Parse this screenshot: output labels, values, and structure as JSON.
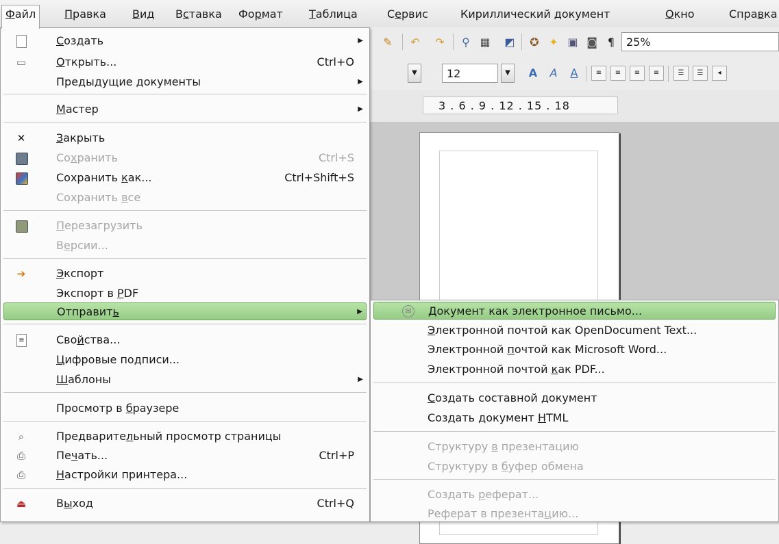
{
  "menubar": {
    "items": [
      {
        "pre": "",
        "acc": "Ф",
        "post": "айл"
      },
      {
        "pre": "",
        "acc": "П",
        "post": "равка"
      },
      {
        "pre": "",
        "acc": "В",
        "post": "ид"
      },
      {
        "pre": "В",
        "acc": "с",
        "post": "тавка"
      },
      {
        "pre": "Фо",
        "acc": "р",
        "post": "мат"
      },
      {
        "pre": "",
        "acc": "Т",
        "post": "аблица"
      },
      {
        "pre": "С",
        "acc": "е",
        "post": "рвис"
      },
      {
        "pre": "Кириллический документ",
        "acc": "",
        "post": ""
      },
      {
        "pre": "",
        "acc": "О",
        "post": "кно"
      },
      {
        "pre": "Спра",
        "acc": "в",
        "post": "ка"
      }
    ]
  },
  "toolbar": {
    "zoom_value": "25%",
    "font_size_value": "12"
  },
  "ruler": {
    "text": "3 . 6 . 9 . 12 . 15 . 18"
  },
  "file_menu": {
    "items": [
      {
        "pre": "",
        "acc": "С",
        "post": "оздать",
        "shortcut": "",
        "submenu": true,
        "icon": "new-document-icon",
        "glyph": ""
      },
      {
        "pre": "",
        "acc": "О",
        "post": "ткрыть...",
        "shortcut": "Ctrl+O",
        "icon": "open-folder-icon",
        "glyph": "▭"
      },
      {
        "pre": "Предыдущие ",
        "acc": "д",
        "post": "окументы",
        "shortcut": "",
        "submenu": true
      },
      {
        "pre": "",
        "acc": "М",
        "post": "астер",
        "shortcut": "",
        "submenu": true
      },
      {
        "pre": "",
        "acc": "З",
        "post": "акрыть",
        "shortcut": "",
        "icon": "close-icon",
        "glyph": "✕"
      },
      {
        "pre": "Со",
        "acc": "х",
        "post": "ранить",
        "shortcut": "Ctrl+S",
        "disabled": true,
        "icon": "save-icon"
      },
      {
        "pre": "Сохранить ",
        "acc": "к",
        "post": "ак...",
        "shortcut": "Ctrl+Shift+S",
        "icon": "save-as-icon"
      },
      {
        "pre": "Сохранить ",
        "acc": "в",
        "post": "се",
        "shortcut": "",
        "disabled": true
      },
      {
        "pre": "",
        "acc": "П",
        "post": "ерезагрузить",
        "shortcut": "",
        "disabled": true,
        "icon": "reload-icon"
      },
      {
        "pre": "В",
        "acc": "е",
        "post": "рсии...",
        "shortcut": "",
        "disabled": true
      },
      {
        "pre": "",
        "acc": "Э",
        "post": "кспорт",
        "shortcut": "",
        "icon": "export-icon",
        "glyph": "➔"
      },
      {
        "pre": "Экспорт в ",
        "acc": "P",
        "post": "DF",
        "shortcut": ""
      },
      {
        "pre": "Отправит",
        "acc": "ь",
        "post": "",
        "shortcut": "",
        "submenu": true,
        "highlighted": true
      },
      {
        "pre": "Сво",
        "acc": "й",
        "post": "ства...",
        "shortcut": "",
        "icon": "properties-icon",
        "glyph": "≡"
      },
      {
        "pre": "",
        "acc": "Ц",
        "post": "ифровые подписи...",
        "shortcut": ""
      },
      {
        "pre": "",
        "acc": "Ш",
        "post": "аблоны",
        "shortcut": "",
        "submenu": true
      },
      {
        "pre": "Просмотр в ",
        "acc": "б",
        "post": "раузере",
        "shortcut": ""
      },
      {
        "pre": "Предварите",
        "acc": "л",
        "post": "ьный просмотр страницы",
        "shortcut": "",
        "icon": "page-preview-icon",
        "glyph": "⌕"
      },
      {
        "pre": "Пе",
        "acc": "ч",
        "post": "ать...",
        "shortcut": "Ctrl+P",
        "icon": "print-icon",
        "glyph": "⎙"
      },
      {
        "pre": "",
        "acc": "Н",
        "post": "астройки принтера...",
        "shortcut": "",
        "icon": "printer-settings-icon",
        "glyph": "⎙"
      },
      {
        "pre": "В",
        "acc": "ы",
        "post": "ход",
        "shortcut": "Ctrl+Q",
        "icon": "exit-icon",
        "glyph": "⏏"
      }
    ]
  },
  "send_submenu": {
    "items": [
      {
        "pre": "",
        "acc": "Д",
        "post": "окумент как электронное письмо...",
        "highlighted": true,
        "icon": "mail-icon",
        "glyph": "✉"
      },
      {
        "pre": "",
        "acc": "Э",
        "post": "лектронной почтой как OpenDocument Text..."
      },
      {
        "pre": "Электронной ",
        "acc": "п",
        "post": "очтой как Microsoft Word..."
      },
      {
        "pre": "Электронной почтой ",
        "acc": "к",
        "post": "ак PDF..."
      },
      {
        "pre": "",
        "acc": "С",
        "post": "оздать составной документ"
      },
      {
        "pre": "Создать документ ",
        "acc": "H",
        "post": "TML"
      },
      {
        "pre": "Структуру ",
        "acc": "в",
        "post": " презентацию",
        "disabled": true
      },
      {
        "pre": "Структуру в ",
        "acc": "б",
        "post": "уфер обмена",
        "disabled": true
      },
      {
        "pre": "Создать ",
        "acc": "р",
        "post": "еферат...",
        "disabled": true
      },
      {
        "pre": "Реферат в презента",
        "acc": "ц",
        "post": "ию...",
        "disabled": true
      }
    ]
  },
  "colors": {
    "highlight": "#a7d896",
    "disabled_text": "#a6a6a6",
    "menu_bg": "#fbfbfb"
  }
}
